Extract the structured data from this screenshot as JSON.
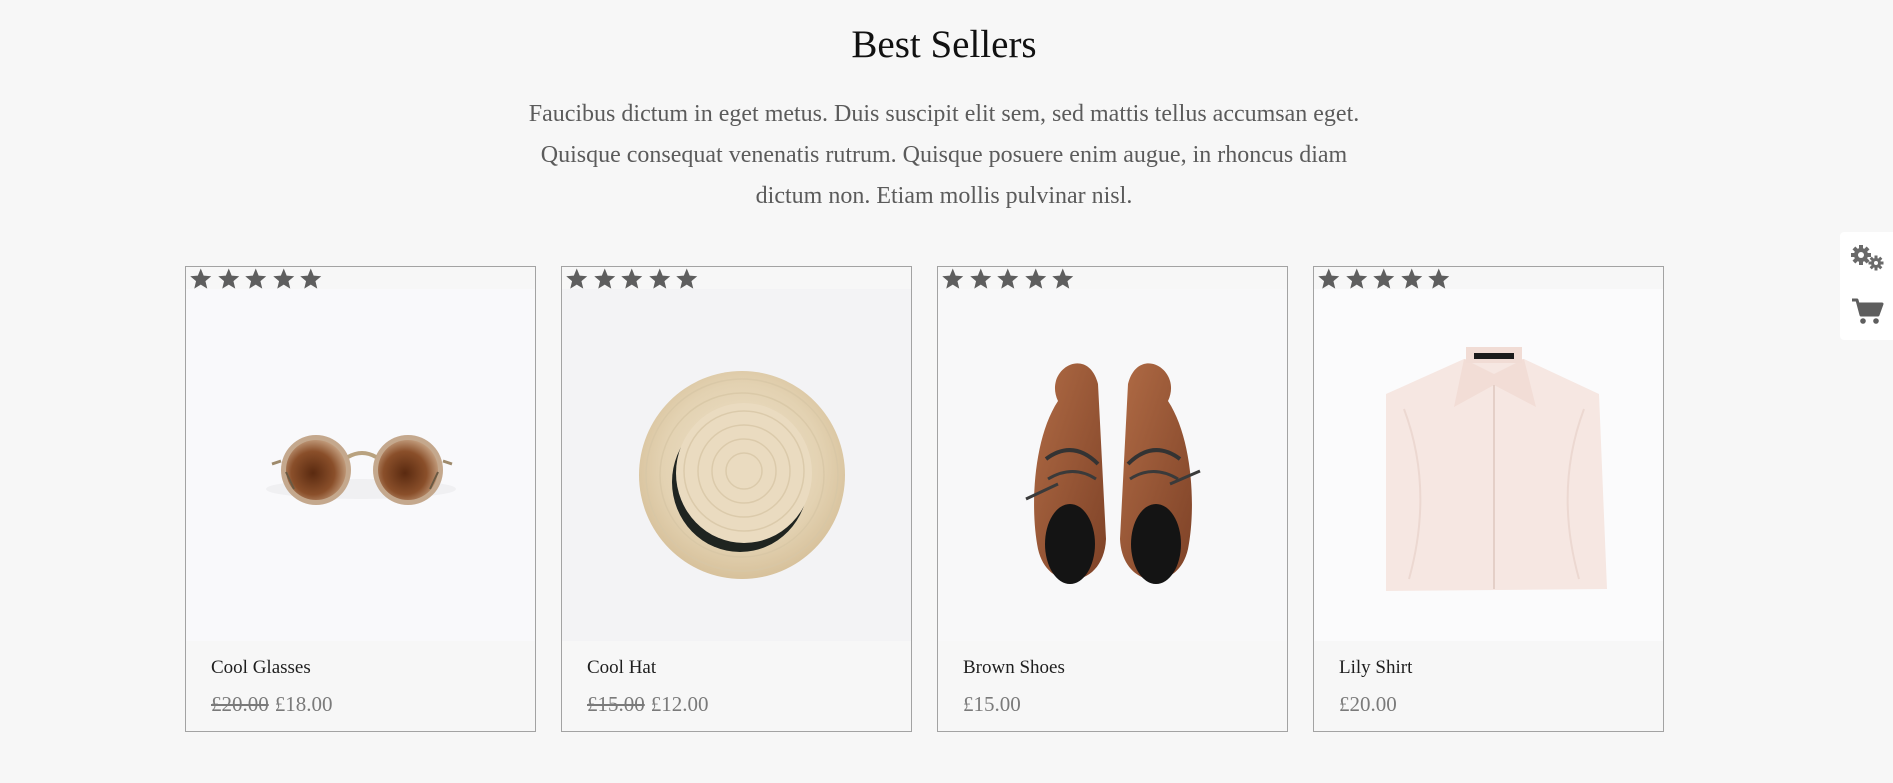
{
  "section": {
    "title": "Best Sellers",
    "intro_lines": [
      "Faucibus dictum in eget metus. Duis suscipit elit sem, sed mattis tellus accumsan eget.",
      "Quisque consequat venenatis rutrum. Quisque posuere enim augue, in rhoncus diam",
      "dictum non. Etiam mollis pulvinar nisl."
    ]
  },
  "products": [
    {
      "name": "Cool Glasses",
      "old_price": "£20.00",
      "price": "£18.00",
      "rating": 5,
      "image": "sunglasses"
    },
    {
      "name": "Cool Hat",
      "old_price": "£15.00",
      "price": "£12.00",
      "rating": 5,
      "image": "straw-hat"
    },
    {
      "name": "Brown Shoes",
      "old_price": "",
      "price": "£15.00",
      "rating": 5,
      "image": "brown-shoes"
    },
    {
      "name": "Lily Shirt",
      "old_price": "",
      "price": "£20.00",
      "rating": 5,
      "image": "folded-shirt"
    }
  ],
  "side_panel": {
    "icons": [
      "gears-icon",
      "cart-icon"
    ]
  },
  "colors": {
    "background": "#f7f7f7",
    "star": "#5e5e5e",
    "price": "#7a7a7a",
    "card_border": "#a3a3a3"
  }
}
